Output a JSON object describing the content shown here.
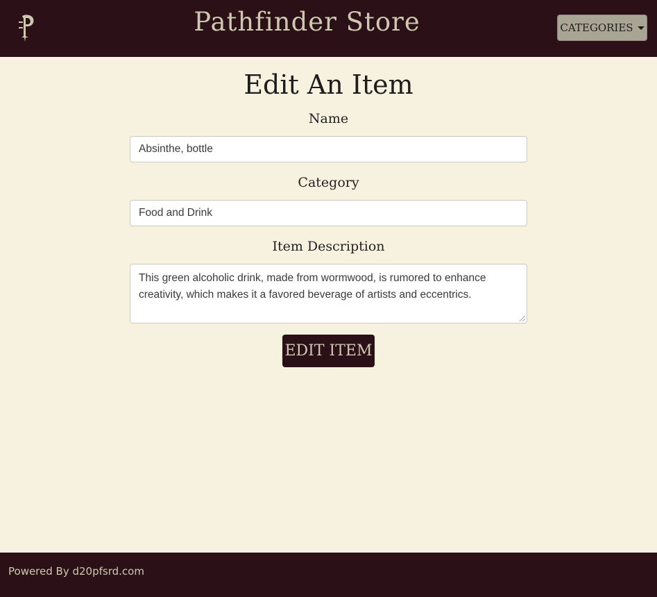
{
  "navbar": {
    "logo_icon": "pathfinder-p-logo",
    "title": "Pathfinder Store",
    "categories_label": "CATEGORIES"
  },
  "page": {
    "title": "Edit An Item"
  },
  "form": {
    "name_label": "Name",
    "name_value": "Absinthe, bottle",
    "category_label": "Category",
    "category_value": "Food and Drink",
    "description_label": "Item Description",
    "description_value": "This green alcoholic drink, made from wormwood, is rumored to enhance creativity, which makes it a favored beverage of artists and eccentrics.",
    "submit_label": "EDIT ITEM"
  },
  "footer": {
    "text": "Powered By d20pfsrd.com"
  },
  "colors": {
    "navbar_bg": "#2b1117",
    "page_bg": "#f7f1e0",
    "accent_text": "#cfc8b0",
    "categories_btn_bg": "#a9a595"
  }
}
